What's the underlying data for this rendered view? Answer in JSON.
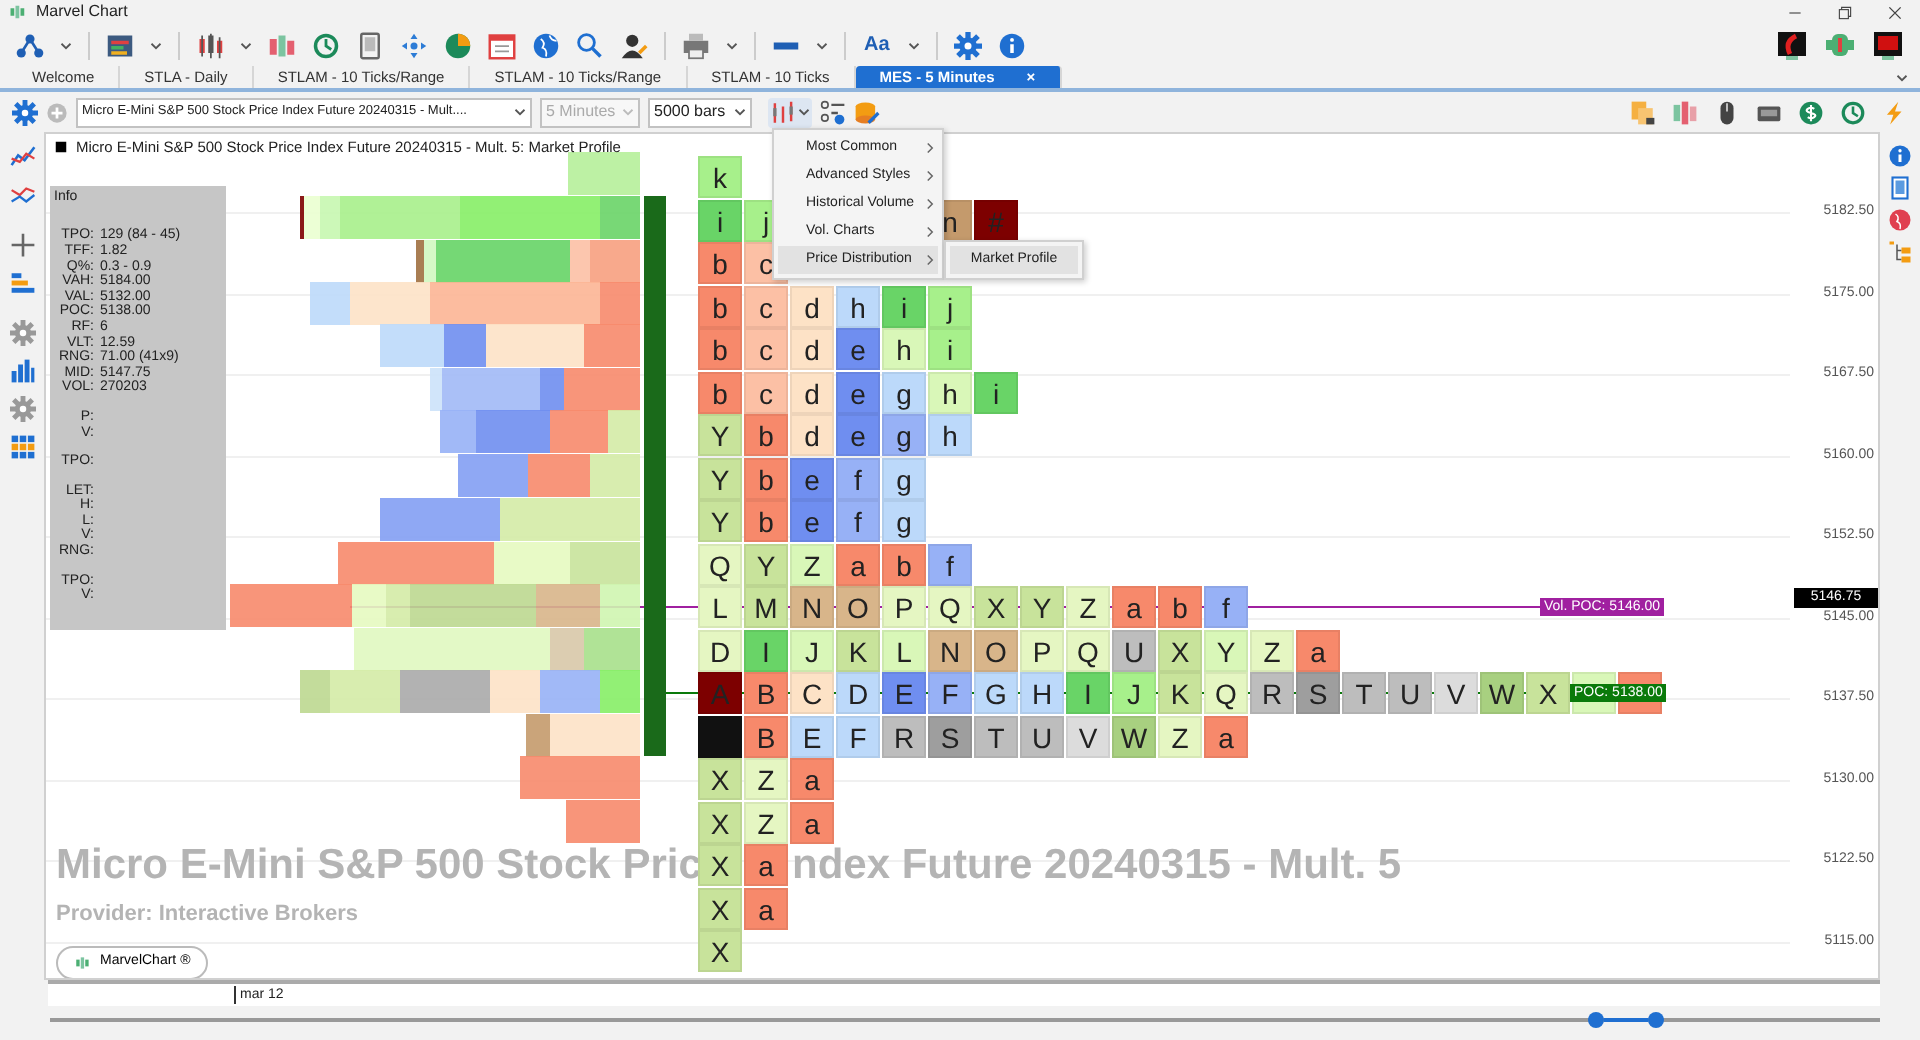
{
  "window": {
    "title": "Marvel Chart"
  },
  "toolbar": {
    "font_button": "Aa"
  },
  "tabs": [
    {
      "label": "Welcome",
      "selected": false
    },
    {
      "label": "STLA - Daily",
      "selected": false
    },
    {
      "label": "STLAM - 10 Ticks/Range",
      "selected": false
    },
    {
      "label": "STLAM - 10 Ticks/Range",
      "selected": false
    },
    {
      "label": "STLAM - 10 Ticks",
      "selected": false
    },
    {
      "label": "MES - 5 Minutes",
      "selected": true,
      "close": "×"
    }
  ],
  "chart_toolbar": {
    "instrument": "Micro E-Mini S&P 500 Stock Price Index Future 20240315 - Mult....",
    "period": {
      "value": "5 Minutes",
      "disabled": true
    },
    "bars": {
      "value": "5000 bars",
      "disabled": false
    },
    "style_menu_expanded": true
  },
  "menu": {
    "items": [
      {
        "label": "Most Common",
        "selected": false
      },
      {
        "label": "Advanced Styles",
        "selected": false
      },
      {
        "label": "Historical Volume",
        "selected": false
      },
      {
        "label": "Vol. Charts",
        "selected": false
      },
      {
        "label": "Price Distribution",
        "selected": true
      }
    ],
    "submenu": [
      {
        "label": "Market Profile",
        "selected": true
      }
    ]
  },
  "chart": {
    "heading": "Micro E-Mini S&P 500 Stock Price Index Future 20240315 - Mult. 5: Market Profile",
    "info": {
      "title": "Info",
      "groups": [
        [
          {
            "label": "TPO:",
            "value": "129 (84 - 45)"
          },
          {
            "label": "TFF:",
            "value": "1.82"
          },
          {
            "label": "Q%:",
            "value": "0.3 - 0.9"
          },
          {
            "label": "VAH:",
            "value": "5184.00"
          },
          {
            "label": "VAL:",
            "value": "5132.00"
          },
          {
            "label": "POC:",
            "value": "5138.00"
          },
          {
            "label": "RF:",
            "value": "6"
          },
          {
            "label": "VLT:",
            "value": "12.59"
          },
          {
            "label": "RNG:",
            "value": "71.00 (41x9)"
          },
          {
            "label": "MID:",
            "value": "5147.75"
          },
          {
            "label": "VOL:",
            "value": "270203"
          }
        ],
        [
          {
            "label": "P:"
          },
          {
            "label": "V:"
          }
        ],
        [
          {
            "label": "TPO:"
          }
        ],
        [
          {
            "label": "LET:"
          },
          {
            "label": "H:"
          },
          {
            "label": "L:"
          },
          {
            "label": "V:"
          },
          {
            "label": "RNG:"
          }
        ],
        [
          {
            "label": "TPO:"
          },
          {
            "label": "V:"
          }
        ]
      ]
    },
    "tpo_rows": [
      {
        "cells": [
          {
            "letter": "k",
            "color": "#a7f08b"
          }
        ]
      },
      {
        "cells": [
          {
            "letter": "i",
            "color": "#69d467"
          },
          {
            "letter": "j",
            "color": "#a7f08b"
          },
          null,
          null,
          null,
          {
            "letter": "n",
            "color": "#c49a6c"
          },
          {
            "letter": "#",
            "color": "#7d0000"
          }
        ]
      },
      {
        "cells": [
          {
            "letter": "b",
            "color": "#f7896b"
          },
          {
            "letter": "c",
            "color": "#fcc0a5"
          }
        ]
      },
      {
        "cells": [
          {
            "letter": "b",
            "color": "#f7896b"
          },
          {
            "letter": "c",
            "color": "#fcc0a5"
          },
          {
            "letter": "d",
            "color": "#fde2c6"
          },
          {
            "letter": "h",
            "color": "#bcd9fa"
          },
          {
            "letter": "i",
            "color": "#69d467"
          },
          {
            "letter": "j",
            "color": "#a7f08b"
          }
        ]
      },
      {
        "cells": [
          {
            "letter": "b",
            "color": "#f7896b"
          },
          {
            "letter": "c",
            "color": "#fcc0a5"
          },
          {
            "letter": "d",
            "color": "#fde2c6"
          },
          {
            "letter": "e",
            "color": "#6f8ef0"
          },
          {
            "letter": "h",
            "color": "#d9f7b8"
          },
          {
            "letter": "i",
            "color": "#a7f08b"
          }
        ]
      },
      {
        "cells": [
          {
            "letter": "b",
            "color": "#f7896b"
          },
          {
            "letter": "c",
            "color": "#fcc0a5"
          },
          {
            "letter": "d",
            "color": "#fde2c6"
          },
          {
            "letter": "e",
            "color": "#6f8ef0"
          },
          {
            "letter": "g",
            "color": "#bcd9fa"
          },
          {
            "letter": "h",
            "color": "#d9f7b8"
          },
          {
            "letter": "i",
            "color": "#69d467"
          }
        ]
      },
      {
        "cells": [
          {
            "letter": "Y",
            "color": "#c8e39b"
          },
          {
            "letter": "b",
            "color": "#f7896b"
          },
          {
            "letter": "d",
            "color": "#fde2c6"
          },
          {
            "letter": "e",
            "color": "#6f8ef0"
          },
          {
            "letter": "g",
            "color": "#97b1f6"
          },
          {
            "letter": "h",
            "color": "#bcd9fa"
          }
        ]
      },
      {
        "cells": [
          {
            "letter": "Y",
            "color": "#c8e39b"
          },
          {
            "letter": "b",
            "color": "#f7896b"
          },
          {
            "letter": "e",
            "color": "#6f8ef0"
          },
          {
            "letter": "f",
            "color": "#97b1f6"
          },
          {
            "letter": "g",
            "color": "#bcd9fa"
          }
        ]
      },
      {
        "cells": [
          {
            "letter": "Y",
            "color": "#c8e39b"
          },
          {
            "letter": "b",
            "color": "#f7896b"
          },
          {
            "letter": "e",
            "color": "#6f8ef0"
          },
          {
            "letter": "f",
            "color": "#97b1f6"
          },
          {
            "letter": "g",
            "color": "#bcd9fa"
          }
        ]
      },
      {
        "cells": [
          {
            "letter": "Q",
            "color": "#e5f6c2"
          },
          {
            "letter": "Y",
            "color": "#c8e39b"
          },
          {
            "letter": "Z",
            "color": "#d9f7b8"
          },
          {
            "letter": "a",
            "color": "#f7896b"
          },
          {
            "letter": "b",
            "color": "#f7896b"
          },
          {
            "letter": "f",
            "color": "#97b1f6"
          }
        ]
      },
      {
        "cells": [
          {
            "letter": "L",
            "color": "#e5f6c2"
          },
          {
            "letter": "M",
            "color": "#c8e39b"
          },
          {
            "letter": "N",
            "color": "#d8b58a"
          },
          {
            "letter": "O",
            "color": "#d8b58a"
          },
          {
            "letter": "P",
            "color": "#e5f6c2"
          },
          {
            "letter": "Q",
            "color": "#e5f6c2"
          },
          {
            "letter": "X",
            "color": "#c8e39b"
          },
          {
            "letter": "Y",
            "color": "#c8e39b"
          },
          {
            "letter": "Z",
            "color": "#e5f6c2"
          },
          {
            "letter": "a",
            "color": "#f7896b"
          },
          {
            "letter": "b",
            "color": "#f7896b"
          },
          {
            "letter": "f",
            "color": "#97b1f6"
          }
        ]
      },
      {
        "cells": [
          {
            "letter": "D",
            "color": "#e5f6c2"
          },
          {
            "letter": "I",
            "color": "#69d467"
          },
          {
            "letter": "J",
            "color": "#d9f7b8"
          },
          {
            "letter": "K",
            "color": "#c8e39b"
          },
          {
            "letter": "L",
            "color": "#d9f7b8"
          },
          {
            "letter": "N",
            "color": "#d8b58a"
          },
          {
            "letter": "O",
            "color": "#d8b58a"
          },
          {
            "letter": "P",
            "color": "#e5f6c2"
          },
          {
            "letter": "Q",
            "color": "#e5f6c2"
          },
          {
            "letter": "U",
            "color": "#bdbdbd"
          },
          {
            "letter": "X",
            "color": "#c8e39b"
          },
          {
            "letter": "Y",
            "color": "#d9f7b8"
          },
          {
            "letter": "Z",
            "color": "#e5f6c2"
          },
          {
            "letter": "a",
            "color": "#f7896b"
          }
        ]
      },
      {
        "cells": [
          {
            "letter": "A",
            "color": "#7d0000"
          },
          {
            "letter": "B",
            "color": "#f7896b"
          },
          {
            "letter": "C",
            "color": "#fde2c6"
          },
          {
            "letter": "D",
            "color": "#bcd9fa"
          },
          {
            "letter": "E",
            "color": "#6f8ef0"
          },
          {
            "letter": "F",
            "color": "#97b1f6"
          },
          {
            "letter": "G",
            "color": "#bcd9fa"
          },
          {
            "letter": "H",
            "color": "#bcd9fa"
          },
          {
            "letter": "I",
            "color": "#69d467"
          },
          {
            "letter": "J",
            "color": "#a7f08b"
          },
          {
            "letter": "K",
            "color": "#c8e39b"
          },
          {
            "letter": "Q",
            "color": "#e5f6c2"
          },
          {
            "letter": "R",
            "color": "#bdbdbd"
          },
          {
            "letter": "S",
            "color": "#9e9e9e"
          },
          {
            "letter": "T",
            "color": "#bdbdbd"
          },
          {
            "letter": "U",
            "color": "#bdbdbd"
          },
          {
            "letter": "V",
            "color": "#dcdcdc"
          },
          {
            "letter": "W",
            "color": "#a8d080"
          },
          {
            "letter": "X",
            "color": "#c8e39b"
          },
          {
            "color": "#d9f7b8"
          },
          {
            "color": "#f7896b"
          }
        ]
      },
      {
        "cells": [
          {
            "color": "#111111"
          },
          {
            "letter": "B",
            "color": "#f7896b"
          },
          {
            "letter": "E",
            "color": "#bcd9fa"
          },
          {
            "letter": "F",
            "color": "#bcd9fa"
          },
          {
            "letter": "R",
            "color": "#bdbdbd"
          },
          {
            "letter": "S",
            "color": "#9e9e9e"
          },
          {
            "letter": "T",
            "color": "#bdbdbd"
          },
          {
            "letter": "U",
            "color": "#bdbdbd"
          },
          {
            "letter": "V",
            "color": "#dcdcdc"
          },
          {
            "letter": "W",
            "color": "#a8d080"
          },
          {
            "letter": "Z",
            "color": "#e5f6c2"
          },
          {
            "letter": "a",
            "color": "#f7896b"
          }
        ]
      },
      {
        "cells": [
          {
            "letter": "X",
            "color": "#c8e39b"
          },
          {
            "letter": "Z",
            "color": "#e5f6c2"
          },
          {
            "letter": "a",
            "color": "#f7896b"
          }
        ]
      },
      {
        "cells": [
          {
            "letter": "X",
            "color": "#c8e39b"
          },
          {
            "letter": "Z",
            "color": "#e5f6c2"
          },
          {
            "letter": "a",
            "color": "#f7896b"
          }
        ]
      },
      {
        "cells": [
          {
            "letter": "X",
            "color": "#c8e39b"
          },
          {
            "letter": "a",
            "color": "#f7896b"
          }
        ]
      },
      {
        "cells": [
          {
            "letter": "X",
            "color": "#c8e39b"
          },
          {
            "letter": "a",
            "color": "#f7896b"
          }
        ]
      },
      {
        "cells": [
          {
            "letter": "X",
            "color": "#c8e39b"
          }
        ]
      }
    ],
    "vol_poc": "Vol. POC: 5146.00",
    "poc": "POC: 5138.00",
    "price_axis": [
      "5182.50",
      "5175.00",
      "5167.50",
      "5160.00",
      "5152.50",
      "5145.00",
      "5137.50",
      "5130.00",
      "5122.50",
      "5115.00"
    ],
    "current_price": "5146.75",
    "overlay_title": [
      "Micro E-Mini S&P 500 Stock Pric",
      "ndex Future 20240315 - Mult. 5"
    ],
    "provider": "Provider: Interactive Brokers",
    "brand_button": "MarvelChart ®",
    "date_axis": [
      "mar 12"
    ]
  }
}
